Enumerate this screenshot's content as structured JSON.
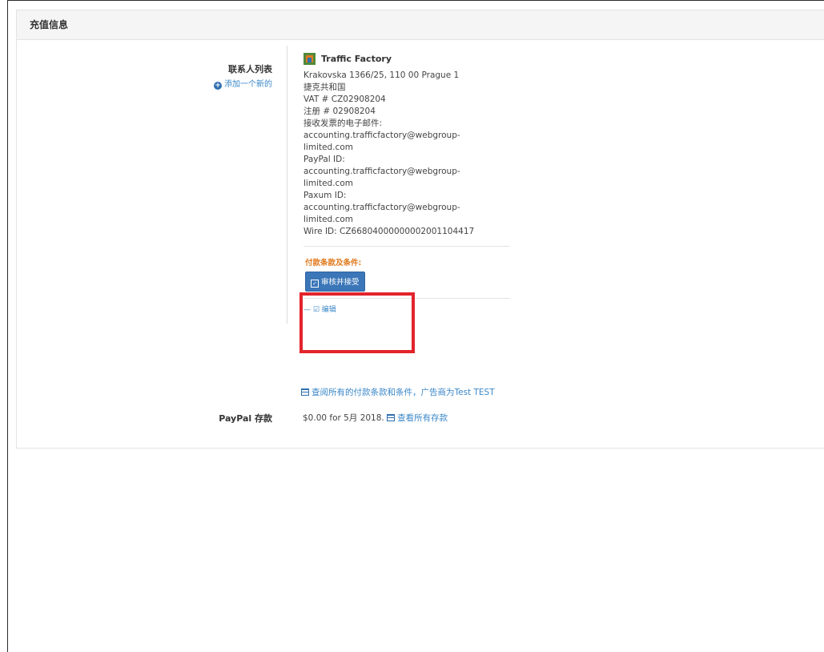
{
  "panel": {
    "title": "充值信息"
  },
  "contacts": {
    "label": "联系人列表",
    "add_new": "添加一个新的",
    "company": "Traffic Factory",
    "lines": [
      "Krakovska 1366/25, 110 00 Prague 1",
      "捷克共和国",
      "VAT # CZ02908204",
      "注册 # 02908204",
      "接收发票的电子邮件:",
      "accounting.trafficfactory@webgroup-",
      "limited.com",
      "PayPal ID:",
      "accounting.trafficfactory@webgroup-",
      "limited.com",
      "Paxum ID:",
      "accounting.trafficfactory@webgroup-",
      "limited.com",
      "Wire ID: CZ66804000000002001104417"
    ],
    "terms_label": "付款条款及条件:",
    "review_button": "审核并接受",
    "edit_link": "— ☑ 编辑"
  },
  "all_terms_link": "查阅所有的付款条款和条件，广告商为Test TEST",
  "paypal": {
    "label": "PayPal 存款",
    "value": "$0.00 for 5月 2018.",
    "view_all": "查看所有存款"
  },
  "colors": {
    "link": "#3a87c8",
    "button": "#3b76b8",
    "terms_label": "#e07a1f",
    "highlight": "#e3242b"
  },
  "icons": {
    "add": "plus-circle-icon",
    "company": "building-icon",
    "review": "checkbox-icon",
    "table": "table-icon"
  }
}
